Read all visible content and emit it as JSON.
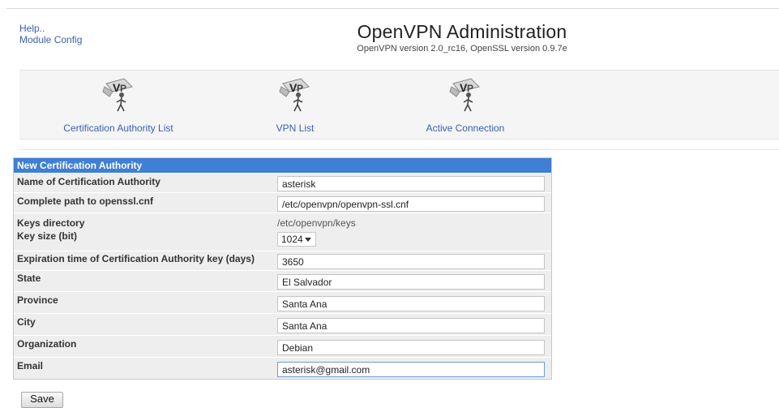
{
  "nav_links": {
    "help": "Help..",
    "module_config": "Module Config"
  },
  "header": {
    "title": "OpenVPN Administration",
    "subtitle": "OpenVPN version 2.0_rc16, OpenSSL version 0.9.7e"
  },
  "toolbar": {
    "items": [
      {
        "label": "Certification Authority List",
        "icon": "openvpn-logo-icon"
      },
      {
        "label": "VPN List",
        "icon": "openvpn-logo-icon"
      },
      {
        "label": "Active Connection",
        "icon": "openvpn-logo-icon"
      }
    ]
  },
  "form": {
    "title": "New Certification Authority",
    "fields": {
      "ca_name": {
        "label": "Name of Certification Authority",
        "value": "asterisk"
      },
      "openssl_path": {
        "label": "Complete path to openssl.cnf",
        "value": "/etc/openvpn/openvpn-ssl.cnf"
      },
      "keys_dir": {
        "label": "Keys directory",
        "value": "/etc/openvpn/keys"
      },
      "key_size": {
        "label": "Key size (bit)",
        "value": "1024"
      },
      "expiration": {
        "label": "Expiration time of Certification Authority key (days)",
        "value": "3650"
      },
      "state": {
        "label": "State",
        "value": "El Salvador"
      },
      "province": {
        "label": "Province",
        "value": "Santa Ana"
      },
      "city": {
        "label": "City",
        "value": "Santa Ana"
      },
      "organization": {
        "label": "Organization",
        "value": "Debian"
      },
      "email": {
        "label": "Email",
        "value": "asterisk@gmail.com"
      }
    },
    "save_label": "Save"
  }
}
